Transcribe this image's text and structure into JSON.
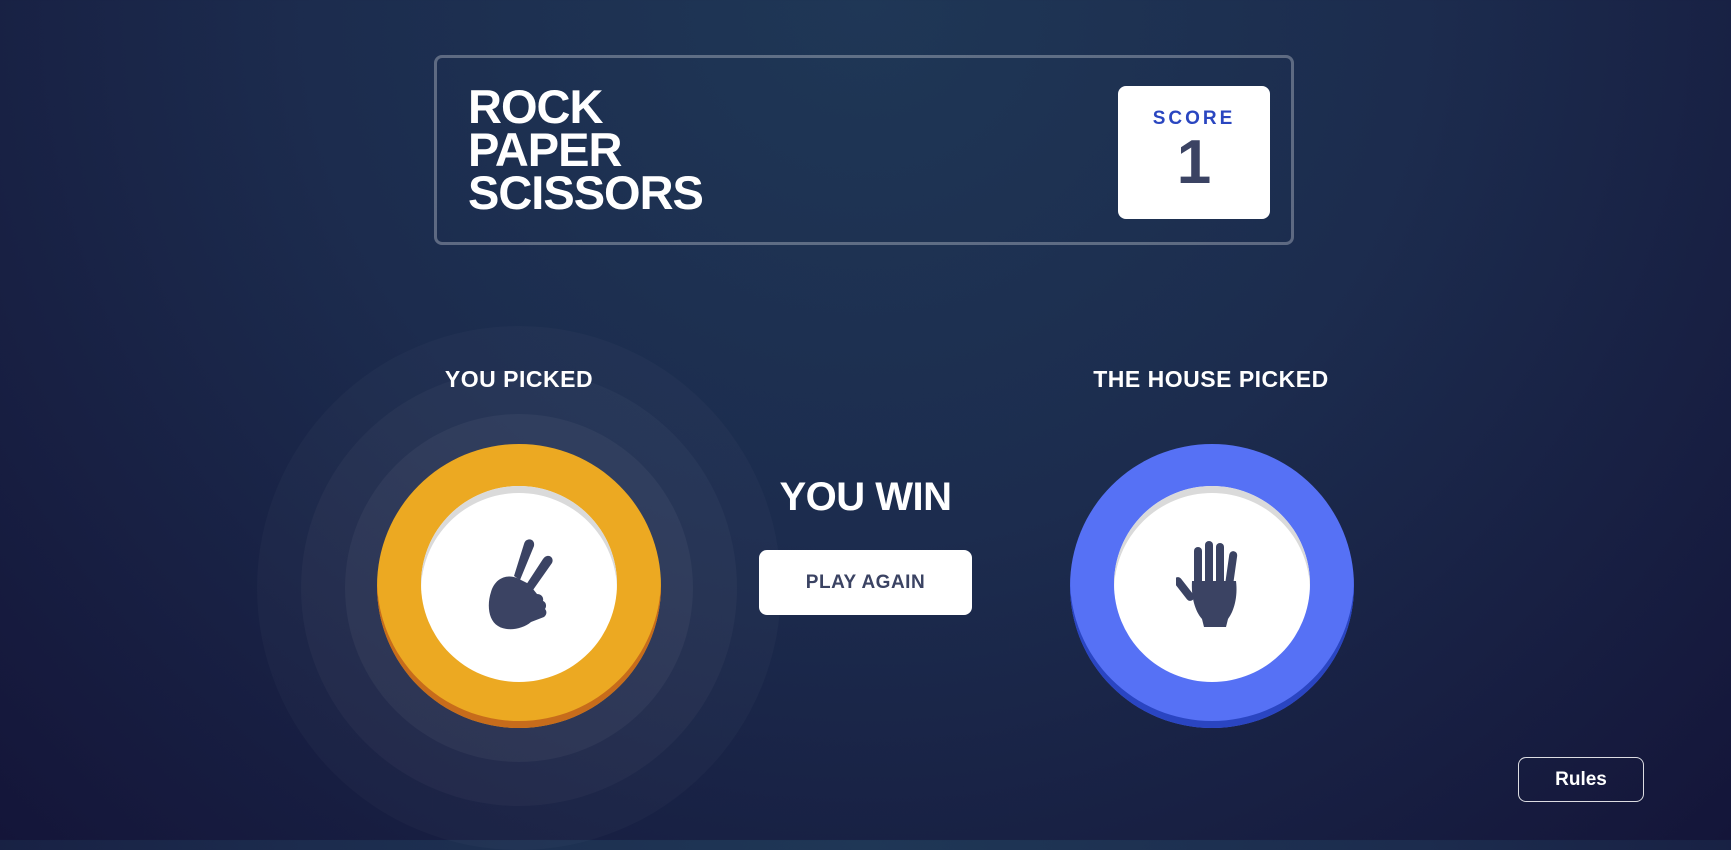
{
  "header": {
    "title_lines": [
      "ROCK",
      "PAPER",
      "SCISSORS"
    ],
    "score_label": "SCORE",
    "score_value": "1"
  },
  "player": {
    "label": "YOU PICKED",
    "choice": "scissors",
    "icon": "scissors-hand-icon",
    "color": "#eca922"
  },
  "house": {
    "label": "THE HOUSE PICKED",
    "choice": "paper",
    "icon": "paper-hand-icon",
    "color": "#5671f5"
  },
  "result": {
    "text": "YOU WIN",
    "play_again_label": "PLAY AGAIN"
  },
  "rules_label": "Rules"
}
